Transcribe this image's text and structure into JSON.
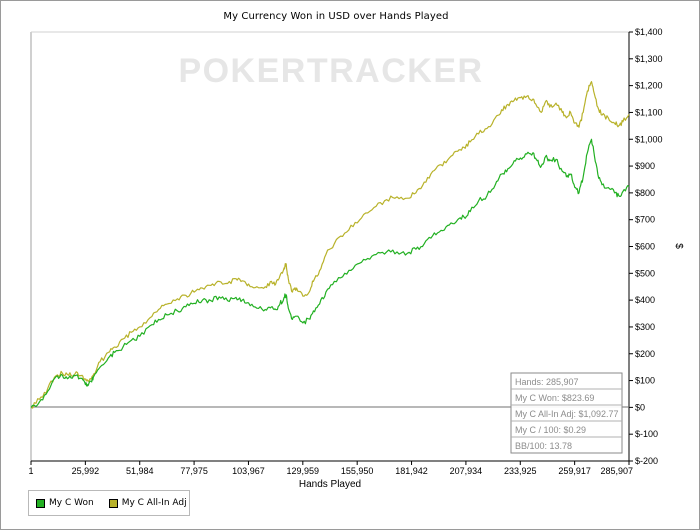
{
  "chart_data": {
    "type": "line",
    "title": "My Currency Won in USD over Hands Played",
    "watermark": "POKERTRACKER",
    "xlabel": "Hands Played",
    "ylabel": "$",
    "xlim": [
      1,
      285907
    ],
    "ylim": [
      -200,
      1400
    ],
    "x_ticks": [
      1,
      25992,
      51984,
      77975,
      103967,
      129959,
      155950,
      181942,
      207934,
      233925,
      259917,
      285907
    ],
    "x_tick_labels": [
      "1",
      "25,992",
      "51,984",
      "77,975",
      "103,967",
      "129,959",
      "155,950",
      "181,942",
      "207,934",
      "233,925",
      "259,917",
      "285,907"
    ],
    "y_ticks": [
      -200,
      -100,
      0,
      100,
      200,
      300,
      400,
      500,
      600,
      700,
      800,
      900,
      1000,
      1100,
      1200,
      1300,
      1400
    ],
    "y_tick_labels": [
      "$-200",
      "$-100",
      "$0",
      "$100",
      "$200",
      "$300",
      "$400",
      "$500",
      "$600",
      "$700",
      "$800",
      "$900",
      "$1,000",
      "$1,100",
      "$1,200",
      "$1,300",
      "$1,400"
    ],
    "grid": false,
    "legend_position": "bottom-left",
    "series": [
      {
        "name": "My C Won",
        "color": "#22b022",
        "points": [
          [
            1,
            0
          ],
          [
            4000,
            20
          ],
          [
            8000,
            60
          ],
          [
            12000,
            115
          ],
          [
            15000,
            120
          ],
          [
            18000,
            110
          ],
          [
            21000,
            118
          ],
          [
            24000,
            108
          ],
          [
            26000,
            85
          ],
          [
            27000,
            80
          ],
          [
            29000,
            95
          ],
          [
            30000,
            115
          ],
          [
            33000,
            150
          ],
          [
            37000,
            185
          ],
          [
            40000,
            205
          ],
          [
            44000,
            225
          ],
          [
            48000,
            250
          ],
          [
            52000,
            265
          ],
          [
            57000,
            305
          ],
          [
            61000,
            328
          ],
          [
            65000,
            345
          ],
          [
            70000,
            360
          ],
          [
            74000,
            375
          ],
          [
            78000,
            388
          ],
          [
            82000,
            400
          ],
          [
            86000,
            398
          ],
          [
            90000,
            412
          ],
          [
            94000,
            398
          ],
          [
            98000,
            410
          ],
          [
            101000,
            400
          ],
          [
            104000,
            390
          ],
          [
            108000,
            370
          ],
          [
            112000,
            365
          ],
          [
            115000,
            375
          ],
          [
            117000,
            365
          ],
          [
            119000,
            385
          ],
          [
            121000,
            410
          ],
          [
            122000,
            420
          ],
          [
            123000,
            370
          ],
          [
            125000,
            328
          ],
          [
            127000,
            340
          ],
          [
            130000,
            315
          ],
          [
            133000,
            330
          ],
          [
            135000,
            360
          ],
          [
            138000,
            385
          ],
          [
            141000,
            430
          ],
          [
            145000,
            470
          ],
          [
            150000,
            500
          ],
          [
            155000,
            530
          ],
          [
            160000,
            550
          ],
          [
            165000,
            570
          ],
          [
            170000,
            580
          ],
          [
            175000,
            580
          ],
          [
            180000,
            575
          ],
          [
            184000,
            590
          ],
          [
            188000,
            610
          ],
          [
            192000,
            640
          ],
          [
            196000,
            660
          ],
          [
            200000,
            680
          ],
          [
            204000,
            700
          ],
          [
            207000,
            710
          ],
          [
            210000,
            730
          ],
          [
            214000,
            770
          ],
          [
            218000,
            790
          ],
          [
            222000,
            830
          ],
          [
            225000,
            870
          ],
          [
            228000,
            890
          ],
          [
            231000,
            920
          ],
          [
            234000,
            930
          ],
          [
            237000,
            945
          ],
          [
            240000,
            950
          ],
          [
            242000,
            920
          ],
          [
            244000,
            900
          ],
          [
            246000,
            935
          ],
          [
            248000,
            920
          ],
          [
            251000,
            925
          ],
          [
            254000,
            880
          ],
          [
            256000,
            860
          ],
          [
            258000,
            870
          ],
          [
            260000,
            820
          ],
          [
            262000,
            800
          ],
          [
            264000,
            860
          ],
          [
            266000,
            950
          ],
          [
            268000,
            1000
          ],
          [
            269000,
            960
          ],
          [
            271000,
            870
          ],
          [
            273000,
            830
          ],
          [
            276000,
            820
          ],
          [
            279000,
            800
          ],
          [
            281000,
            790
          ],
          [
            283000,
            805
          ],
          [
            285907,
            823.69
          ]
        ]
      },
      {
        "name": "My C All-In Adj",
        "color": "#b8b22a",
        "points": [
          [
            1,
            0
          ],
          [
            4000,
            30
          ],
          [
            8000,
            70
          ],
          [
            12000,
            118
          ],
          [
            15000,
            127
          ],
          [
            18000,
            120
          ],
          [
            21000,
            125
          ],
          [
            24000,
            118
          ],
          [
            26000,
            105
          ],
          [
            27000,
            102
          ],
          [
            29000,
            110
          ],
          [
            30000,
            125
          ],
          [
            33000,
            170
          ],
          [
            37000,
            205
          ],
          [
            40000,
            225
          ],
          [
            44000,
            255
          ],
          [
            48000,
            280
          ],
          [
            52000,
            300
          ],
          [
            57000,
            335
          ],
          [
            61000,
            365
          ],
          [
            65000,
            385
          ],
          [
            70000,
            405
          ],
          [
            74000,
            418
          ],
          [
            78000,
            430
          ],
          [
            82000,
            445
          ],
          [
            86000,
            455
          ],
          [
            90000,
            470
          ],
          [
            94000,
            462
          ],
          [
            98000,
            480
          ],
          [
            101000,
            472
          ],
          [
            104000,
            460
          ],
          [
            108000,
            450
          ],
          [
            112000,
            450
          ],
          [
            115000,
            470
          ],
          [
            117000,
            460
          ],
          [
            119000,
            490
          ],
          [
            121000,
            520
          ],
          [
            122000,
            535
          ],
          [
            123000,
            480
          ],
          [
            125000,
            430
          ],
          [
            127000,
            445
          ],
          [
            130000,
            415
          ],
          [
            133000,
            430
          ],
          [
            135000,
            470
          ],
          [
            138000,
            510
          ],
          [
            141000,
            570
          ],
          [
            145000,
            610
          ],
          [
            150000,
            650
          ],
          [
            155000,
            690
          ],
          [
            160000,
            725
          ],
          [
            165000,
            750
          ],
          [
            170000,
            775
          ],
          [
            175000,
            785
          ],
          [
            180000,
            780
          ],
          [
            184000,
            800
          ],
          [
            188000,
            840
          ],
          [
            192000,
            880
          ],
          [
            196000,
            905
          ],
          [
            200000,
            930
          ],
          [
            204000,
            955
          ],
          [
            207000,
            970
          ],
          [
            210000,
            990
          ],
          [
            214000,
            1020
          ],
          [
            218000,
            1040
          ],
          [
            222000,
            1080
          ],
          [
            225000,
            1110
          ],
          [
            228000,
            1130
          ],
          [
            231000,
            1145
          ],
          [
            234000,
            1155
          ],
          [
            237000,
            1160
          ],
          [
            240000,
            1150
          ],
          [
            242000,
            1120
          ],
          [
            244000,
            1100
          ],
          [
            246000,
            1140
          ],
          [
            248000,
            1120
          ],
          [
            251000,
            1135
          ],
          [
            254000,
            1100
          ],
          [
            256000,
            1080
          ],
          [
            258000,
            1100
          ],
          [
            260000,
            1060
          ],
          [
            262000,
            1045
          ],
          [
            264000,
            1100
          ],
          [
            266000,
            1180
          ],
          [
            268000,
            1215
          ],
          [
            269000,
            1180
          ],
          [
            271000,
            1120
          ],
          [
            273000,
            1090
          ],
          [
            276000,
            1080
          ],
          [
            279000,
            1060
          ],
          [
            281000,
            1050
          ],
          [
            283000,
            1065
          ],
          [
            285907,
            1092.77
          ]
        ]
      }
    ],
    "info_box": [
      "Hands: 285,907",
      "My C Won: $823.69",
      "My C All-In Adj: $1,092.77",
      "My C / 100: $0.29",
      "BB/100: 13.78"
    ],
    "colors": {
      "axis": "#000000",
      "zero_line": "#707070",
      "watermark": "#e6e6e6",
      "info_border": "#8a8a8a",
      "info_text": "#8c8c8c"
    }
  }
}
